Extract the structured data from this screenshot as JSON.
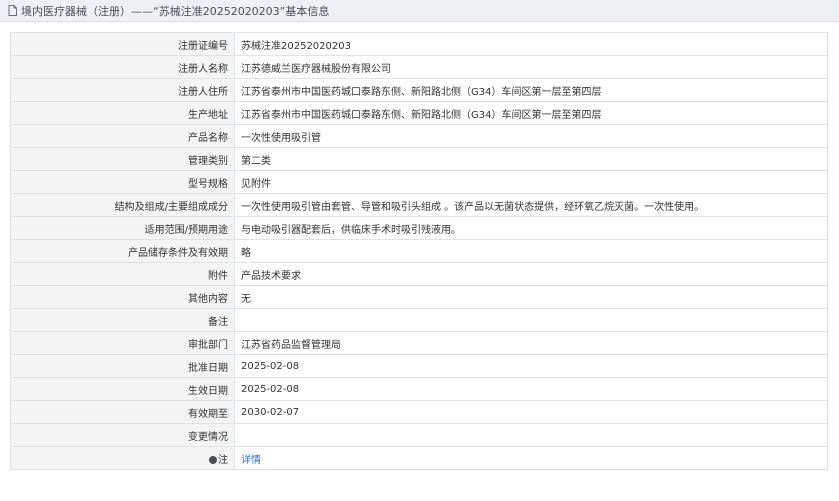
{
  "page": {
    "title": "境内医疗器械（注册）——“苏械注准20252020203”基本信息",
    "icons": {
      "header": "document-icon",
      "note": "pin-icon"
    }
  },
  "rows": [
    {
      "key": "registration_number",
      "label": "注册证编号",
      "value": "苏械注准20252020203"
    },
    {
      "key": "registrant_name",
      "label": "注册人名称",
      "value": "江苏德威兰医疗器械股份有限公司"
    },
    {
      "key": "registrant_address",
      "label": "注册人住所",
      "value": "江苏省泰州市中国医药城口泰路东侧、新阳路北侧（G34）车间区第一层至第四层"
    },
    {
      "key": "production_address",
      "label": "生产地址",
      "value": "江苏省泰州市中国医药城口泰路东侧、新阳路北侧（G34）车间区第一层至第四层"
    },
    {
      "key": "product_name",
      "label": "产品名称",
      "value": "一次性使用吸引管"
    },
    {
      "key": "management_category",
      "label": "管理类别",
      "value": "第二类"
    },
    {
      "key": "model_spec",
      "label": "型号规格",
      "value": "见附件"
    },
    {
      "key": "structure_composition",
      "label": "结构及组成/主要组成成分",
      "value": "一次性使用吸引管由套管、导管和吸引头组成 。该产品以无菌状态提供，经环氧乙烷灭菌。一次性使用。"
    },
    {
      "key": "intended_use",
      "label": "适用范围/预期用途",
      "value": "与电动吸引器配套后，供临床手术时吸引残液用。"
    },
    {
      "key": "storage_validity",
      "label": "产品储存条件及有效期",
      "value": "略"
    },
    {
      "key": "attachment",
      "label": "附件",
      "value": "产品技术要求"
    },
    {
      "key": "other_content",
      "label": "其他内容",
      "value": "无"
    },
    {
      "key": "remarks",
      "label": "备注",
      "value": ""
    },
    {
      "key": "approval_department",
      "label": "审批部门",
      "value": "江苏省药品监督管理局"
    },
    {
      "key": "approval_date",
      "label": "批准日期",
      "value": "2025-02-08"
    },
    {
      "key": "effective_date",
      "label": "生效日期",
      "value": "2025-02-08"
    },
    {
      "key": "valid_until",
      "label": "有效期至",
      "value": "2030-02-07"
    },
    {
      "key": "change_status",
      "label": "变更情况",
      "value": ""
    }
  ],
  "note_row": {
    "label": "注",
    "link_text": "详情"
  },
  "colors": {
    "header_background": "#eef0f3",
    "label_background": "#f4f4f5",
    "border": "#dfe2e6",
    "link": "#2f6fd6"
  }
}
